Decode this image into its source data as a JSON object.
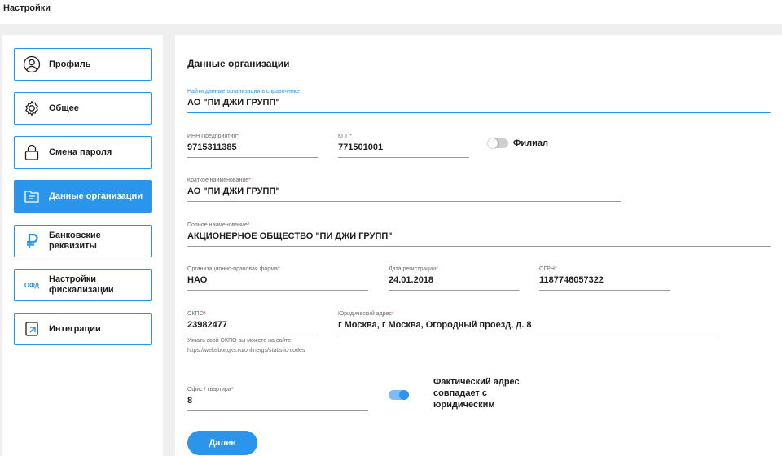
{
  "page": {
    "title": "Настройки"
  },
  "sidebar": {
    "items": [
      {
        "label": "Профиль",
        "icon": "user-circle-icon"
      },
      {
        "label": "Общее",
        "icon": "gear-icon"
      },
      {
        "label": "Смена пароля",
        "icon": "lock-icon"
      },
      {
        "label": "Данные организации",
        "icon": "folder-icon",
        "active": true
      },
      {
        "label": "Банковские реквизиты",
        "icon": "ruble-icon"
      },
      {
        "label": "Настройки фискализации",
        "icon": "ofd-icon",
        "icon_text": "ОФД"
      },
      {
        "label": "Интеграции",
        "icon": "integration-icon"
      }
    ]
  },
  "main": {
    "title": "Данные организации",
    "search": {
      "label": "Найти данные организации в справочнике",
      "value": "АО \"ПИ ДЖИ ГРУПП\""
    },
    "inn": {
      "label": "ИНН Предприятия",
      "value": "9715311385"
    },
    "kpp": {
      "label": "КПП",
      "value": "771501001"
    },
    "branch": {
      "label": "Филиал",
      "on": false
    },
    "short_name": {
      "label": "Краткое наименование",
      "value": "АО \"ПИ ДЖИ ГРУПП\""
    },
    "full_name": {
      "label": "Полное наименование",
      "value": "АКЦИОНЕРНОЕ ОБЩЕСТВО \"ПИ ДЖИ ГРУПП\""
    },
    "legal_form": {
      "label": "Организационно-правовая форма",
      "value": "НАО"
    },
    "reg_date": {
      "label": "Дата регистрации",
      "value": "24.01.2018"
    },
    "ogrn": {
      "label": "ОГРН",
      "value": "1187746057322"
    },
    "okpo": {
      "label": "ОКПО",
      "value": "23982477",
      "hint": "Узнать свой ОКПО вы можете на сайте: https://websbor.gks.ru/online/gs/statistic-codes"
    },
    "legal_address": {
      "label": "Юридический адрес",
      "value": "г Москва, г Москва, Огородный проезд, д. 8"
    },
    "office": {
      "label": "Офис / квартира",
      "value": "8"
    },
    "same_address": {
      "label": "Фактический адрес совпадает с юридическим",
      "on": true
    },
    "next_button": "Далее"
  },
  "colors": {
    "accent": "#2a95ea",
    "required": "#e8463c",
    "background": "#efefef"
  }
}
